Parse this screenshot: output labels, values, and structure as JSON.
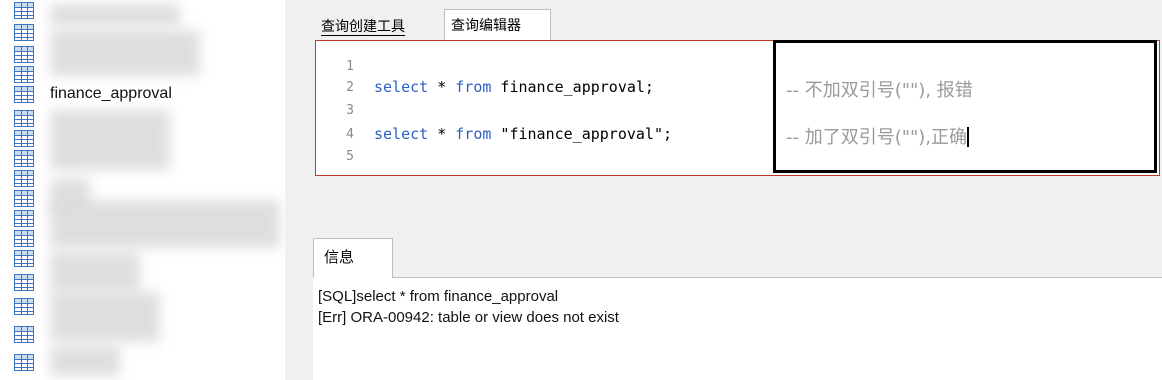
{
  "sidebar": {
    "tables": [
      {
        "label": ""
      },
      {
        "label": ""
      },
      {
        "label": ""
      },
      {
        "label": "finance_approval"
      },
      {
        "label": ""
      },
      {
        "label": ""
      },
      {
        "label": ""
      },
      {
        "label": ""
      },
      {
        "label": ""
      },
      {
        "label": ""
      },
      {
        "label": ""
      },
      {
        "label": ""
      },
      {
        "label": ""
      },
      {
        "label": ""
      },
      {
        "label": ""
      },
      {
        "label": ""
      },
      {
        "label": ""
      }
    ],
    "icon": "table-icon"
  },
  "tabs": {
    "query_builder": "查询创建工具",
    "query_editor": "查询编辑器"
  },
  "editor": {
    "lines": [
      {
        "number": "1",
        "keyword_select": "",
        "rest": ""
      },
      {
        "number": "2",
        "keyword_select": "select",
        "star": " * ",
        "keyword_from": "from",
        "target": " finance_approval;"
      },
      {
        "number": "3"
      },
      {
        "number": "4",
        "keyword_select": "select",
        "star": " * ",
        "keyword_from": "from",
        "target": " \"finance_approval\";"
      },
      {
        "number": "5"
      }
    ],
    "comments": {
      "line2": "-- 不加双引号(\"\"), 报错",
      "line4": "-- 加了双引号(\"\"),正确"
    }
  },
  "info": {
    "tab_label": "信息",
    "messages": [
      "[SQL]select * from finance_approval",
      "[Err] ORA-00942: table or view does not exist"
    ]
  },
  "colors": {
    "keyword": "#2e5fc4",
    "editor_border": "#c0392b",
    "comment": "#9a9a9a",
    "table_icon": "#3f74b8"
  }
}
